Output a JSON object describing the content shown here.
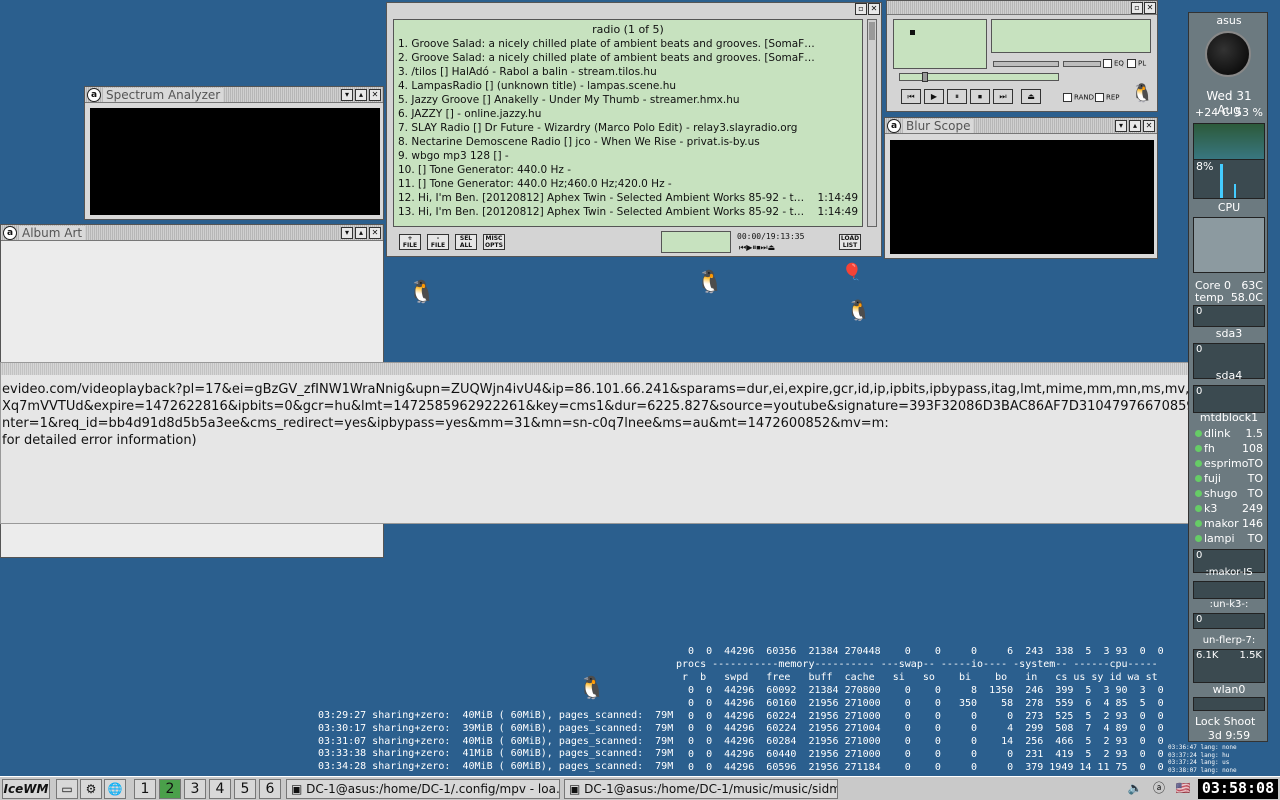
{
  "spectrum": {
    "title": "Spectrum Analyzer"
  },
  "album_art": {
    "title": "Album Art"
  },
  "blur_scope": {
    "title": "Blur Scope"
  },
  "playlist": {
    "header": "radio (1 of 5)",
    "items": [
      {
        "n": "1.",
        "text": "Groove Salad: a nicely chilled plate of ambient beats and grooves. [SomaF…",
        "dur": ""
      },
      {
        "n": "2.",
        "text": "Groove Salad: a nicely chilled plate of ambient beats and grooves. [SomaF…",
        "dur": ""
      },
      {
        "n": "3.",
        "text": "/tilos [] HalAdó - Rabol a balin - stream.tilos.hu",
        "dur": ""
      },
      {
        "n": "4.",
        "text": "LampasRadio [] (unknown title) - lampas.scene.hu",
        "dur": ""
      },
      {
        "n": "5.",
        "text": "Jazzy Groove [] Anakelly - Under My Thumb - streamer.hmx.hu",
        "dur": ""
      },
      {
        "n": "6.",
        "text": "JAZZY [] - online.jazzy.hu",
        "dur": ""
      },
      {
        "n": "7.",
        "text": "SLAY Radio [] Dr Future - Wizardry (Marco Polo Edit) - relay3.slayradio.org",
        "dur": ""
      },
      {
        "n": "8.",
        "text": "Nectarine Demoscene Radio [] jco - When We Rise - privat.is-by.us",
        "dur": ""
      },
      {
        "n": "9.",
        "text": "wbgo mp3 128 [] -",
        "dur": ""
      },
      {
        "n": "10.",
        "text": "[] Tone Generator: 440.0 Hz -",
        "dur": ""
      },
      {
        "n": "11.",
        "text": "[] Tone Generator: 440.0 Hz;460.0 Hz;420.0 Hz -",
        "dur": ""
      },
      {
        "n": "12.",
        "text": "Hi, I'm Ben. [20120812] Aphex Twin - Selected Ambient Works 85-92 - t…",
        "dur": "1:14:49"
      },
      {
        "n": "13.",
        "text": "Hi, I'm Ben. [20120812] Aphex Twin - Selected Ambient Works 85-92 - t…",
        "dur": "1:14:49"
      }
    ],
    "buttons": {
      "add": "+\nFILE",
      "sub": "-\nFILE",
      "sel": "SEL\nALL",
      "misc": "MISC\nOPTS",
      "load": "LOAD\nLIST"
    },
    "time": "00:00/19:13:35"
  },
  "player": {
    "rand": "RAND",
    "rep": "REP",
    "eq": "EQ",
    "pl": "PL"
  },
  "terminal": {
    "lines": [
      "evideo.com/videoplayback?pl=17&ei=gBzGV_zfINW1WraNnig&upn=ZUQWjn4ivU4&ip=86.101.66.241&sparams=dur,ei,expire,gcr,id,ip,ipbits,ipbypass,itag,lmt,mime,mm,mn,ms,mv,nh,pl,rat",
      "Xq7mVVTUd&expire=1472622816&ipbits=0&gcr=hu&lmt=1472585962922261&key=cms1&dur=6225.827&source=youtube&signature=393F32086D3BAC86AF7D31047976670859E1AFEB.27",
      "nter=1&req_id=bb4d91d8d5b5a3ee&cms_redirect=yes&ipbypass=yes&mm=31&mn=sn-c0q7lnee&ms=au&mt=1472600852&mv=m:",
      " for detailed error information)"
    ]
  },
  "vmstat": {
    "top": "  0  0  44296  60356  21384 270448    0    0     0     6  243  338  5  3 93  0  0",
    "hdr1": "procs -----------memory---------- ---swap-- -----io---- -system-- ------cpu-----",
    "hdr2": " r  b   swpd   free   buff  cache   si   so    bi    bo   in   cs us sy id wa st",
    "rows": [
      "  0  0  44296  60092  21384 270800    0    0     8  1350  246  399  5  3 90  3  0",
      "  0  0  44296  60160  21956 271000    0    0   350    58  278  559  6  4 85  5  0",
      "  0  0  44296  60224  21956 271000    0    0     0     0  273  525  5  2 93  0  0",
      "  0  0  44296  60224  21956 271004    0    0     0     4  299  508  7  4 89  0  0",
      "  0  0  44296  60284  21956 271000    0    0     0    14  256  466  5  2 93  0  0",
      "  0  0  44296  60440  21956 271000    0    0     0     0  231  419  5  2 93  0  0",
      "  0  0  44296  60596  21956 271184    0    0     0     0  379 1949 14 11 75  0  0"
    ],
    "ksm": [
      "03:29:27 sharing+zero:  40MiB ( 60MiB), pages_scanned:  79M",
      "03:30:17 sharing+zero:  39MiB ( 60MiB), pages_scanned:  79M",
      "03:31:07 sharing+zero:  40MiB ( 60MiB), pages_scanned:  79M",
      "03:33:38 sharing+zero:  41MiB ( 60MiB), pages_scanned:  79M",
      "03:34:28 sharing+zero:  40MiB ( 60MiB), pages_scanned:  79M"
    ],
    "side": [
      "03:36:47 lang: none",
      "03:37:24 lang: hu",
      "03:37:24 lang: us",
      "03:38:07 lang: none"
    ]
  },
  "gkrellm": {
    "host": "asus",
    "date": "Wed 31 Aug",
    "temp": "+24 C",
    "hum": "53 %",
    "cpu_pct": "8%",
    "cpu_label": "CPU",
    "core_label": "Core 0",
    "core_val": "63C",
    "temp_label": "temp",
    "temp_val": "58.0C",
    "zero": "0",
    "sda3": "sda3",
    "sda4": "sda4",
    "md": "mtdblock1",
    "hosts": [
      {
        "name": "dlink",
        "val": "1.5"
      },
      {
        "name": "fh",
        "val": "108"
      },
      {
        "name": "esprimo",
        "val": "TO"
      },
      {
        "name": "fuji",
        "val": "TO"
      },
      {
        "name": "shugo",
        "val": "TO"
      },
      {
        "name": "k3",
        "val": "249"
      },
      {
        "name": "makor",
        "val": "146"
      },
      {
        "name": "lampi",
        "val": "TO"
      }
    ],
    "t1": ":makor-IS",
    "t2": ":un-k3-:",
    "t3": "un-flerp-7:",
    "net_rx": "6.1K",
    "net_tx": "1.5K",
    "wlan": "wlan0",
    "lock": "Lock",
    "shoot": "Shoot",
    "uptime": "3d  9:59"
  },
  "taskbar": {
    "start": "IceWM",
    "workspaces": [
      "1",
      "2",
      "3",
      "4",
      "5",
      "6"
    ],
    "active_ws": "2",
    "task1": "DC-1@asus:/home/DC-1/.config/mpv - loa...",
    "task2": "DC-1@asus:/home/DC-1/music/music/sidm...",
    "clock": "03:58:08"
  },
  "colors": {
    "desktop": "#2b5f8e",
    "lcd": "#c7e2bf",
    "active_ws": "#4aa04a"
  }
}
